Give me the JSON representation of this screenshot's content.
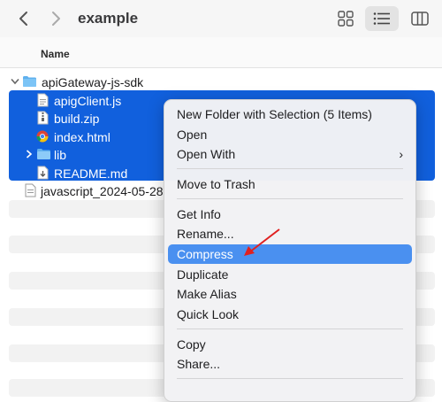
{
  "window": {
    "title": "example"
  },
  "toolbar": {
    "back_icon": "chevron-left-icon",
    "forward_icon": "chevron-right-icon",
    "views": [
      "grid-view-icon",
      "list-view-icon",
      "column-view-icon"
    ]
  },
  "table": {
    "column_name": "Name"
  },
  "files": {
    "folder": "apiGateway-js-sdk",
    "items": [
      {
        "name": "apigClient.js",
        "icon": "js-file-icon"
      },
      {
        "name": "build.zip",
        "icon": "zip-file-icon"
      },
      {
        "name": "index.html",
        "icon": "chrome-html-icon"
      },
      {
        "name": "lib",
        "icon": "folder-icon"
      },
      {
        "name": "README.md",
        "icon": "markdown-file-icon"
      }
    ],
    "other": "javascript_2024-05-28"
  },
  "context_menu": {
    "new_folder": "New Folder with Selection (5 Items)",
    "open": "Open",
    "open_with": "Open With",
    "move_to_trash": "Move to Trash",
    "get_info": "Get Info",
    "rename": "Rename...",
    "compress": "Compress",
    "duplicate": "Duplicate",
    "make_alias": "Make Alias",
    "quick_look": "Quick Look",
    "copy": "Copy",
    "share": "Share..."
  },
  "colors": {
    "selection": "#1160dd",
    "highlight": "#4a90f0",
    "arrow": "#e02020"
  }
}
